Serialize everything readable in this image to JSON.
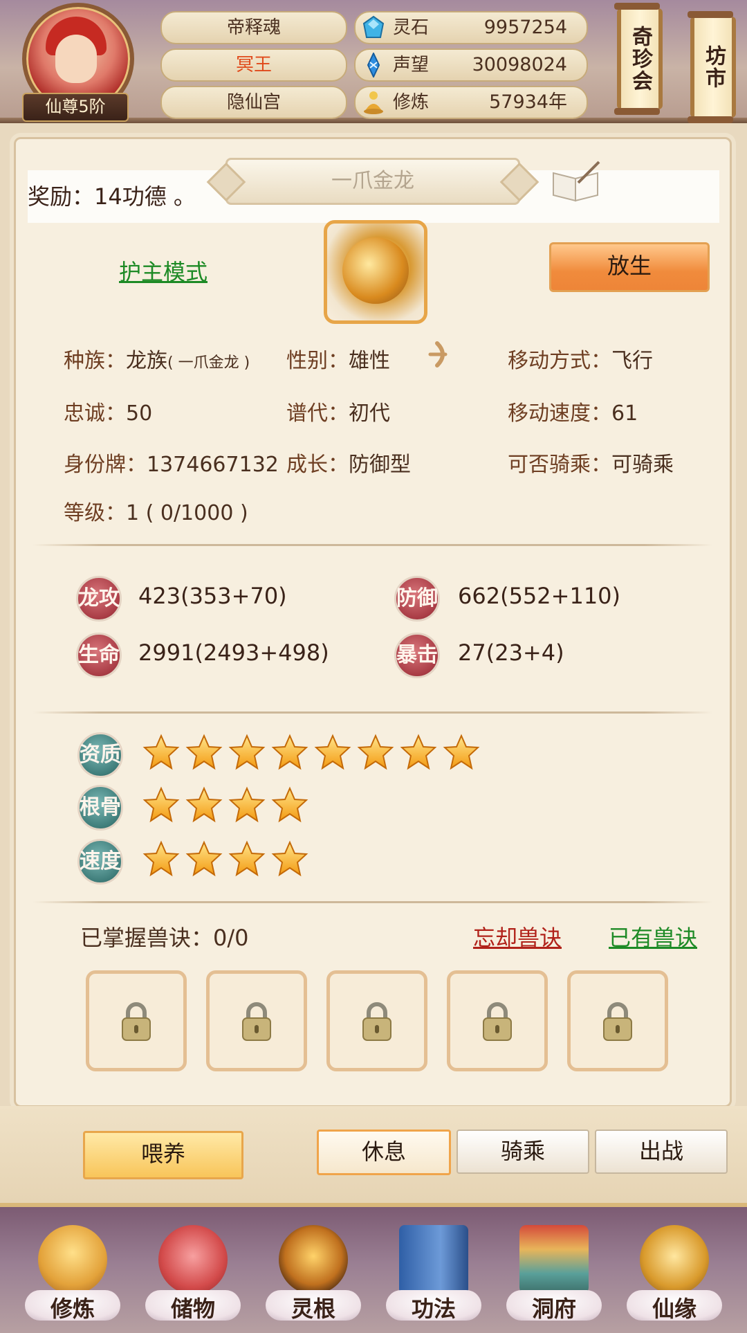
{
  "header": {
    "rank": "仙尊5阶",
    "names": [
      "帝释魂",
      "冥王",
      "隐仙宫"
    ],
    "resources": [
      {
        "icon": "spirit-stone-icon",
        "label": "灵石",
        "value": "9957254"
      },
      {
        "icon": "reputation-crystal-icon",
        "label": "声望",
        "value": "30098024"
      },
      {
        "icon": "cultivation-meditation-icon",
        "label": "修炼",
        "value": "57934年"
      }
    ],
    "scrolls": [
      "奇珍会",
      "坊市"
    ]
  },
  "pet": {
    "name": "一爪金龙",
    "notice": "奖励：14功德 。",
    "guard_mode": "护主模式",
    "release": "放生",
    "info": {
      "race_label": "种族：",
      "race_value": "龙族",
      "race_sub": "( 一爪金龙 )",
      "gender_label": "性别：",
      "gender_value": "雄性",
      "move_label": "移动方式：",
      "move_value": "飞行",
      "loyalty_label": "忠诚：",
      "loyalty_value": "50",
      "generation_label": "谱代：",
      "generation_value": "初代",
      "speed_label": "移动速度：",
      "speed_value": "61",
      "id_label": "身份牌：",
      "id_value": "1374667132",
      "growth_label": "成长：",
      "growth_value": "防御型",
      "ride_label": "可否骑乘：",
      "ride_value": "可骑乘",
      "level_label": "等级：",
      "level_value": "1 ( 0/1000 )"
    },
    "stats": [
      {
        "label": "龙攻",
        "value": "423(353+70)"
      },
      {
        "label": "防御",
        "value": "662(552+110)"
      },
      {
        "label": "生命",
        "value": "2991(2493+498)"
      },
      {
        "label": "暴击",
        "value": "27(23+4)"
      }
    ],
    "aptitudes": [
      {
        "label": "资质",
        "stars": 8
      },
      {
        "label": "根骨",
        "stars": 4
      },
      {
        "label": "速度",
        "stars": 4
      }
    ],
    "skills": {
      "label": "已掌握兽诀：0/0",
      "forget": "忘却兽诀",
      "owned": "已有兽诀",
      "slots": 5
    }
  },
  "actions": {
    "feed": "喂养",
    "rest": "休息",
    "ride": "骑乘",
    "battle": "出战",
    "active": "rest"
  },
  "nav": [
    "修炼",
    "储物",
    "灵根",
    "功法",
    "洞府",
    "仙缘"
  ],
  "colors": {
    "accent_orange": "#f08b3c",
    "link_green": "#1d8a25",
    "link_red": "#b1221a",
    "name_red": "#e0491a"
  }
}
